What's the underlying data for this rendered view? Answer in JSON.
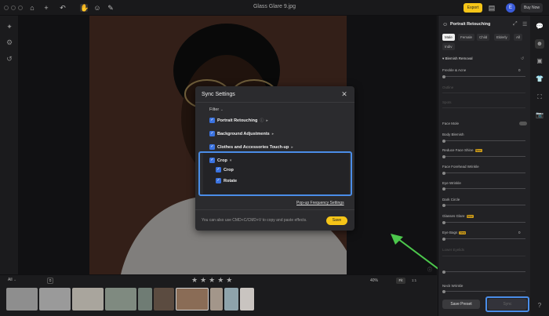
{
  "title_bar": {
    "document_title": "Glass Glare 9.jpg",
    "export_label": "Export",
    "avatar_letter": "E",
    "buy_label": "Buy Now"
  },
  "sync_dialog": {
    "title": "Sync Settings",
    "filter_label": "Filter",
    "items": [
      {
        "label": "Portrait Retouching",
        "checked": true
      },
      {
        "label": "Background Adjustments",
        "checked": true
      },
      {
        "label": "Clothes and Accessories Touch-up",
        "checked": true
      },
      {
        "label": "Crop",
        "checked": true
      },
      {
        "label": "Crop",
        "checked": true
      },
      {
        "label": "Rotate",
        "checked": true
      }
    ],
    "frequency_link": "Pop-up Frequency Settings",
    "tip": "You can also use CMD+C/CMD+V to copy and paste effects.",
    "save_label": "Save"
  },
  "right_panel": {
    "title": "Portrait Retouching",
    "gender_tabs": [
      "Male",
      "Female",
      "Child",
      "Elderly",
      "All"
    ],
    "extra_tab": "Indiv",
    "section": "Blemish Removal",
    "freckle_label": "Freckle & Acne",
    "freckle_value": "0",
    "faint_1": "Outline",
    "faint_2": "Spots",
    "face_mole": "Face Mole",
    "body_blemish": "Body Blemish",
    "reduce_face_shine": "Reduce Face Shine",
    "new_badge": "New",
    "forehead_wrinkle": "Face Forehead Wrinkle",
    "eye_wrinkle": "Eye Wrinkle",
    "dark_circle": "Dark Circle",
    "glasses_glare": "Glasses Glare",
    "eye_bags": "Eye Bags",
    "eye_bags_value": "0",
    "faint_3": "Lower Eyelids",
    "neck_wrinkle": "Neck Wrinkle",
    "save_preset_label": "Save Preset",
    "sync_label": "Sync"
  },
  "bottom": {
    "filter_select": "All",
    "stars": "★★★★★",
    "zoom": "40%",
    "fit_label": "Fit",
    "one_label": "1:1"
  },
  "colors": {
    "accent": "#f5c518",
    "highlight": "#4a8de8",
    "arrow": "#4cc74c",
    "checkbox": "#3b73e0"
  }
}
